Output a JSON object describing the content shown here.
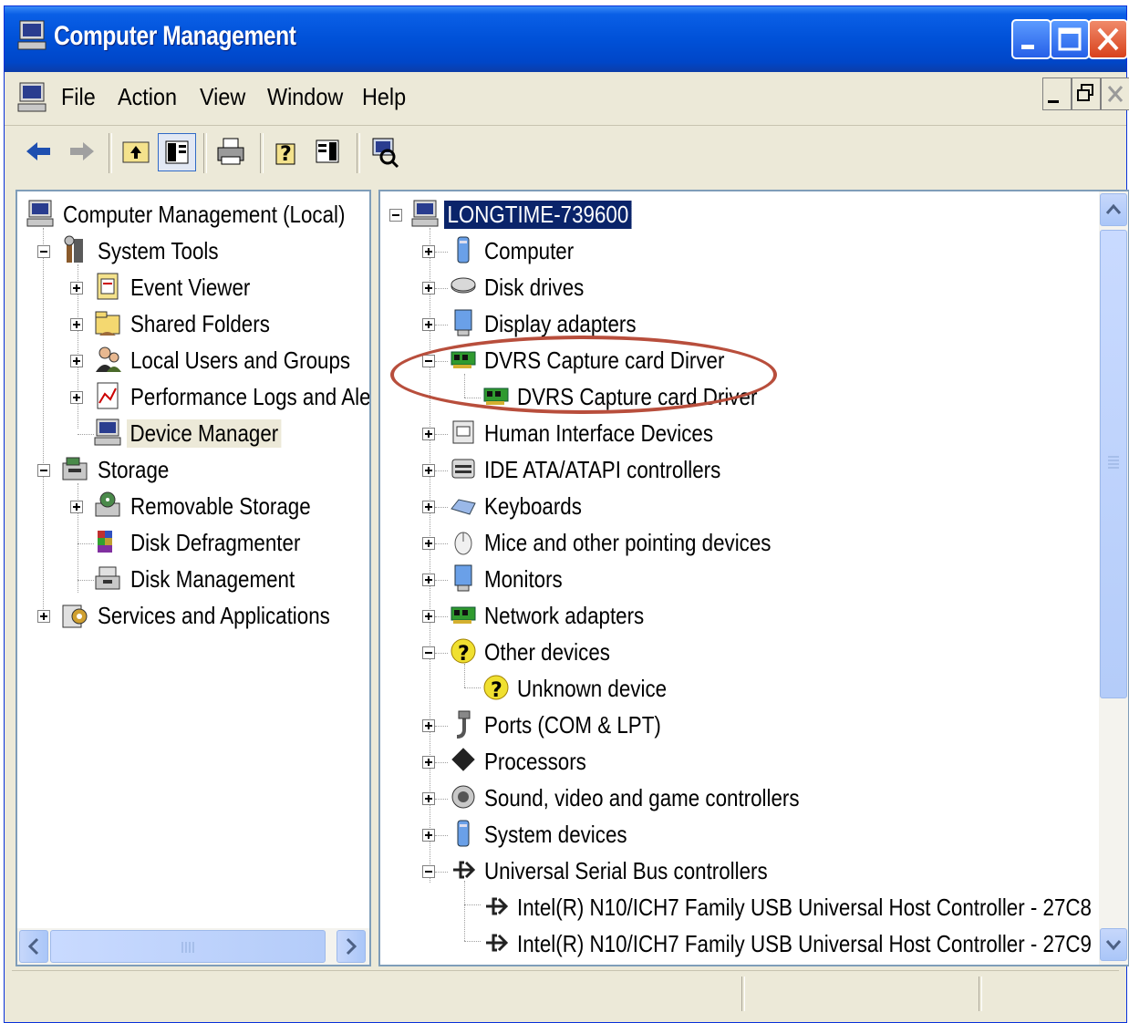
{
  "window": {
    "title": "Computer Management"
  },
  "menu": {
    "file": "File",
    "action": "Action",
    "view": "View",
    "window": "Window",
    "help": "Help"
  },
  "left_tree": {
    "root": "Computer Management (Local)",
    "system_tools": "System Tools",
    "event_viewer": "Event Viewer",
    "shared_folders": "Shared Folders",
    "local_users": "Local Users and Groups",
    "perf_logs": "Performance Logs and Alert:",
    "device_manager": "Device Manager",
    "storage": "Storage",
    "removable_storage": "Removable Storage",
    "disk_defrag": "Disk Defragmenter",
    "disk_management": "Disk Management",
    "services": "Services and Applications"
  },
  "right_tree": {
    "root": "LONGTIME-739600",
    "items": [
      "Computer",
      "Disk drives",
      "Display adapters",
      "DVRS Capture card Dirver",
      "DVRS Capture card Driver",
      "Human Interface Devices",
      "IDE ATA/ATAPI controllers",
      "Keyboards",
      "Mice and other pointing devices",
      "Monitors",
      "Network adapters",
      "Other devices",
      "Unknown device",
      "Ports (COM & LPT)",
      "Processors",
      "Sound, video and game controllers",
      "System devices",
      "Universal Serial Bus controllers",
      "Intel(R) N10/ICH7 Family USB Universal Host Controller - 27C8",
      "Intel(R) N10/ICH7 Family USB Universal Host Controller - 27C9"
    ]
  },
  "colors": {
    "titlebar": "#0051d8",
    "selection": "#0a246a",
    "highlight_ring": "#b84e3c"
  }
}
